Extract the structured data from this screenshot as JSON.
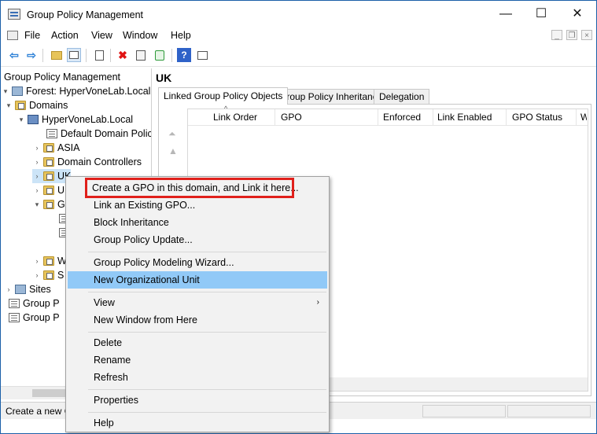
{
  "window": {
    "title": "Group Policy Management",
    "minimize": "—",
    "maximize": "☐",
    "close": "✕"
  },
  "menu": [
    "File",
    "Action",
    "View",
    "Window",
    "Help"
  ],
  "mdi": {
    "min": "_",
    "restore": "❐",
    "close": "×"
  },
  "toolbar": {
    "icons": [
      "back-arrow-icon",
      "forward-arrow-icon",
      "up-folder-icon",
      "show-hide-tree-icon",
      "properties-icon",
      "delete-icon",
      "export-list-icon",
      "refresh-icon",
      "help-icon",
      "action-pane-icon"
    ],
    "glyphs": {
      "back": "⇦",
      "forward": "⇨",
      "help": "?",
      "delete": "✖"
    },
    "colors": {
      "arrows": "#2b7fd6",
      "delete": "#e01414",
      "help": "#2f62c8",
      "refresh": "#2e9a3a"
    }
  },
  "tree": {
    "items": [
      {
        "label": "Group Policy Management",
        "icon": "gpm-icon",
        "toggle": ""
      },
      {
        "label": "Forest: HyperVoneLab.Local",
        "icon": "forest-icon",
        "toggle": "▾"
      },
      {
        "label": "Domains",
        "icon": "folder-icon",
        "toggle": "▾"
      },
      {
        "label": "HyperVoneLab.Local",
        "icon": "domain-icon",
        "toggle": "▾"
      },
      {
        "label": "Default Domain Polic",
        "icon": "gpo-link-icon",
        "toggle": ""
      },
      {
        "label": "ASIA",
        "icon": "ou-folder-icon",
        "toggle": "›"
      },
      {
        "label": "Domain Controllers",
        "icon": "ou-folder-icon",
        "toggle": "›"
      },
      {
        "label": "UK",
        "icon": "ou-folder-icon",
        "toggle": "›"
      },
      {
        "label": "U",
        "icon": "ou-folder-icon",
        "toggle": "›"
      },
      {
        "label": "G",
        "icon": "folder-icon",
        "toggle": "▾"
      },
      {
        "label": "",
        "icon": "gpo-icon",
        "toggle": ""
      },
      {
        "label": "",
        "icon": "gpo-icon",
        "toggle": ""
      },
      {
        "label": "W",
        "icon": "folder-icon",
        "toggle": "›"
      },
      {
        "label": "S",
        "icon": "folder-icon",
        "toggle": "›"
      },
      {
        "label": "Sites",
        "icon": "sites-icon",
        "toggle": "›"
      },
      {
        "label": "Group P",
        "icon": "gpo-icon",
        "toggle": ""
      },
      {
        "label": "Group P",
        "icon": "gpo-icon",
        "toggle": ""
      }
    ]
  },
  "right_pane": {
    "header": "UK",
    "tabs": [
      "Linked Group Policy Objects",
      "Group Policy Inheritance",
      "Delegation"
    ],
    "columns": [
      "Link Order",
      "GPO",
      "Enforced",
      "Link Enabled",
      "GPO Status",
      "W"
    ],
    "sort_glyph": "^",
    "move_glyphs": [
      "⏶",
      "▲"
    ]
  },
  "status": {
    "text": "Create a new G"
  },
  "context_menu": {
    "items": [
      {
        "label": "Create a GPO in this domain, and Link it here...",
        "highlight": false,
        "boxed": true
      },
      {
        "label": "Link an Existing GPO...",
        "highlight": false,
        "boxed": false
      },
      {
        "label": "Block Inheritance",
        "highlight": false,
        "boxed": false
      },
      {
        "label": "Group Policy Update...",
        "highlight": false,
        "boxed": false
      },
      {
        "label": "Group Policy Modeling Wizard...",
        "highlight": false,
        "boxed": false
      },
      {
        "label": "New Organizational Unit",
        "highlight": true,
        "boxed": false
      },
      {
        "label": "View",
        "highlight": false,
        "boxed": false,
        "submenu": "›"
      },
      {
        "label": "New Window from Here",
        "highlight": false,
        "boxed": false
      },
      {
        "label": "Delete",
        "highlight": false,
        "boxed": false
      },
      {
        "label": "Rename",
        "highlight": false,
        "boxed": false
      },
      {
        "label": "Refresh",
        "highlight": false,
        "boxed": false
      },
      {
        "label": "Properties",
        "highlight": false,
        "boxed": false
      },
      {
        "label": "Help",
        "highlight": false,
        "boxed": false
      }
    ],
    "highlight_color": "#91c9f7",
    "box_color": "#e0201b"
  }
}
